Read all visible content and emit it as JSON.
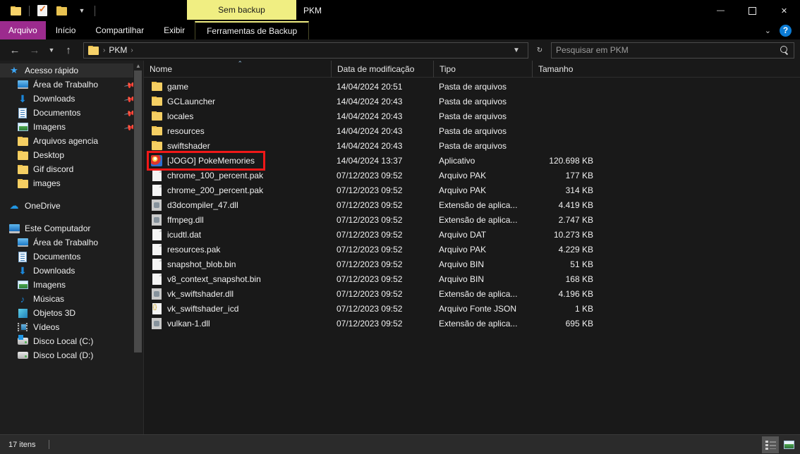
{
  "titlebar": {
    "quick_access": [
      {
        "name": "folder-icon",
        "label": ""
      },
      {
        "name": "properties-icon",
        "label": ""
      },
      {
        "name": "new-folder-icon",
        "label": ""
      },
      {
        "name": "customize-qat-dropdown",
        "label": "▾"
      }
    ],
    "contextual_tab_header": "Sem backup",
    "window_title": "PKM",
    "minimize": "—",
    "maximize": "☐",
    "close": "✕"
  },
  "ribbon": {
    "tabs": [
      {
        "label": "Arquivo",
        "active": true
      },
      {
        "label": "Início",
        "active": false
      },
      {
        "label": "Compartilhar",
        "active": false
      },
      {
        "label": "Exibir",
        "active": false
      }
    ],
    "contextual_tab": "Ferramentas de Backup",
    "collapse_icon": "⌄",
    "help_label": "?"
  },
  "addressbar": {
    "back_icon": "←",
    "forward_icon": "→",
    "recent_icon": "⌄",
    "up_icon": "↑",
    "breadcrumbs": [
      "PKM"
    ],
    "separator": "›",
    "history_dropdown_icon": "⌄",
    "refresh_icon": "↻"
  },
  "search": {
    "placeholder": "Pesquisar em PKM",
    "value": "",
    "icon": "search-icon"
  },
  "sidebar": {
    "groups": [
      {
        "header": {
          "label": "Acesso rápido",
          "icon": "star-icon",
          "selected": true
        },
        "items": [
          {
            "label": "Área de Trabalho",
            "icon": "monitor-icon",
            "pinned": true
          },
          {
            "label": "Downloads",
            "icon": "download-icon",
            "pinned": true
          },
          {
            "label": "Documentos",
            "icon": "document-icon",
            "pinned": true
          },
          {
            "label": "Imagens",
            "icon": "pictures-icon",
            "pinned": true
          },
          {
            "label": "Arquivos agencia",
            "icon": "folder-icon",
            "pinned": false
          },
          {
            "label": "Desktop",
            "icon": "folder-icon",
            "pinned": false
          },
          {
            "label": "Gif discord",
            "icon": "folder-icon",
            "pinned": false
          },
          {
            "label": "images",
            "icon": "folder-icon",
            "pinned": false
          }
        ]
      },
      {
        "header": {
          "label": "OneDrive",
          "icon": "cloud-icon",
          "selected": false
        },
        "items": []
      },
      {
        "header": {
          "label": "Este Computador",
          "icon": "computer-icon",
          "selected": false
        },
        "items": [
          {
            "label": "Área de Trabalho",
            "icon": "monitor-icon",
            "pinned": false
          },
          {
            "label": "Documentos",
            "icon": "document-icon",
            "pinned": false
          },
          {
            "label": "Downloads",
            "icon": "download-icon",
            "pinned": false
          },
          {
            "label": "Imagens",
            "icon": "pictures-icon",
            "pinned": false
          },
          {
            "label": "Músicas",
            "icon": "music-icon",
            "pinned": false
          },
          {
            "label": "Objetos 3D",
            "icon": "3d-objects-icon",
            "pinned": false
          },
          {
            "label": "Vídeos",
            "icon": "video-icon",
            "pinned": false
          },
          {
            "label": "Disco Local (C:)",
            "icon": "windows-drive-icon",
            "pinned": false
          },
          {
            "label": "Disco Local (D:)",
            "icon": "drive-icon",
            "pinned": false
          }
        ]
      }
    ]
  },
  "filelist": {
    "columns": [
      {
        "label": "Nome",
        "sorted": "asc",
        "caret": "⌃"
      },
      {
        "label": "Data de modificação"
      },
      {
        "label": "Tipo"
      },
      {
        "label": "Tamanho"
      }
    ],
    "rows": [
      {
        "name": "game",
        "icon": "folder-icon",
        "modified": "14/04/2024 20:51",
        "type": "Pasta de arquivos",
        "size": ""
      },
      {
        "name": "GCLauncher",
        "icon": "folder-icon",
        "modified": "14/04/2024 20:43",
        "type": "Pasta de arquivos",
        "size": ""
      },
      {
        "name": "locales",
        "icon": "folder-icon",
        "modified": "14/04/2024 20:43",
        "type": "Pasta de arquivos",
        "size": ""
      },
      {
        "name": "resources",
        "icon": "folder-icon",
        "modified": "14/04/2024 20:43",
        "type": "Pasta de arquivos",
        "size": ""
      },
      {
        "name": "swiftshader",
        "icon": "folder-icon",
        "modified": "14/04/2024 20:43",
        "type": "Pasta de arquivos",
        "size": ""
      },
      {
        "name": "[JOGO] PokeMemories",
        "icon": "app-icon",
        "modified": "14/04/2024 13:37",
        "type": "Aplicativo",
        "size": "120.698 KB",
        "highlighted": true
      },
      {
        "name": "chrome_100_percent.pak",
        "icon": "file-icon",
        "modified": "07/12/2023 09:52",
        "type": "Arquivo PAK",
        "size": "177 KB"
      },
      {
        "name": "chrome_200_percent.pak",
        "icon": "file-icon",
        "modified": "07/12/2023 09:52",
        "type": "Arquivo PAK",
        "size": "314 KB"
      },
      {
        "name": "d3dcompiler_47.dll",
        "icon": "dll-icon",
        "modified": "07/12/2023 09:52",
        "type": "Extensão de aplica...",
        "size": "4.419 KB"
      },
      {
        "name": "ffmpeg.dll",
        "icon": "dll-icon",
        "modified": "07/12/2023 09:52",
        "type": "Extensão de aplica...",
        "size": "2.747 KB"
      },
      {
        "name": "icudtl.dat",
        "icon": "file-icon",
        "modified": "07/12/2023 09:52",
        "type": "Arquivo DAT",
        "size": "10.273 KB"
      },
      {
        "name": "resources.pak",
        "icon": "file-icon",
        "modified": "07/12/2023 09:52",
        "type": "Arquivo PAK",
        "size": "4.229 KB"
      },
      {
        "name": "snapshot_blob.bin",
        "icon": "file-icon",
        "modified": "07/12/2023 09:52",
        "type": "Arquivo BIN",
        "size": "51 KB"
      },
      {
        "name": "v8_context_snapshot.bin",
        "icon": "file-icon",
        "modified": "07/12/2023 09:52",
        "type": "Arquivo BIN",
        "size": "168 KB"
      },
      {
        "name": "vk_swiftshader.dll",
        "icon": "dll-icon",
        "modified": "07/12/2023 09:52",
        "type": "Extensão de aplica...",
        "size": "4.196 KB"
      },
      {
        "name": "vk_swiftshader_icd",
        "icon": "json-icon",
        "modified": "07/12/2023 09:52",
        "type": "Arquivo Fonte JSON",
        "size": "1 KB"
      },
      {
        "name": "vulkan-1.dll",
        "icon": "dll-icon",
        "modified": "07/12/2023 09:52",
        "type": "Extensão de aplica...",
        "size": "695 KB"
      }
    ]
  },
  "annotation": {
    "color": "#f01818",
    "target": "[JOGO] PokeMemories"
  },
  "statusbar": {
    "item_count": "17 itens",
    "views": [
      {
        "name": "details-view-button",
        "active": true
      },
      {
        "name": "large-icons-view-button",
        "active": false
      }
    ]
  },
  "colors": {
    "accent_purple": "#9c2b8e",
    "contextual_yellow": "#f0ee82",
    "annotation_red": "#f01818",
    "folder_yellow": "#f5cf63"
  }
}
